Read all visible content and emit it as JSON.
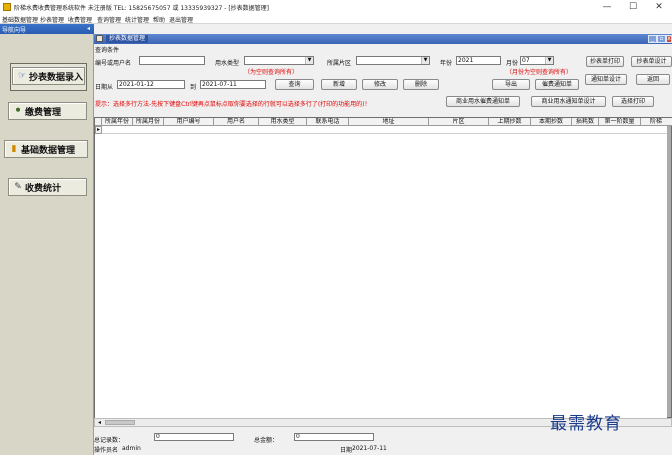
{
  "window": {
    "title": "阶梯水费收费管理系统软件 未注册版 TEL: 15825675057 或 13335939327 - [抄表数据管理]",
    "min_glyph": "—",
    "max_glyph": "☐",
    "close_glyph": "✕"
  },
  "menubar": [
    "基础数据管理",
    "抄表管理",
    "收费管理",
    "查询管理",
    "统计管理",
    "帮助",
    "退出管理"
  ],
  "nav": {
    "header": "导航向导",
    "pin": "◂",
    "items": [
      {
        "label": "抄表数据录入",
        "icon": "☞",
        "icon_name": "hand-icon"
      },
      {
        "label": "缴费管理",
        "icon": "⚫",
        "icon_name": "money-bag-icon"
      },
      {
        "label": "基础数据管理",
        "icon": "▮",
        "icon_name": "database-icon"
      },
      {
        "label": "收费统计",
        "icon": "✎",
        "icon_name": "chart-icon"
      }
    ]
  },
  "child": {
    "tab": "抄表数据管理",
    "min": "_",
    "max": "▫",
    "close": "x"
  },
  "query": {
    "group_title": "查询条件",
    "no_or_name_label": "编号或用户名",
    "no_or_name_value": "",
    "water_type_label": "用水类型",
    "water_type_value": "",
    "water_type_hint": "（为空则查询所有）",
    "area_label": "所属片区",
    "area_value": "",
    "year_label": "年份",
    "year_value": "2021",
    "month_label": "月份",
    "month_value": "07",
    "month_hint": "（月份为空则查询所有）",
    "date_from_label": "日期从",
    "date_from_value": "2021-01-12",
    "date_to_label": "到",
    "date_to_value": "2021-07-11",
    "tip": "提示：选择多行方法-先按下键盘Ctrl键再点鼠标点取你要选择的行就可以选择多行了(打印的功能用的)！",
    "dropdown_glyph": "▼"
  },
  "buttons": {
    "query": "查询",
    "add": "新增",
    "edit": "修改",
    "delete": "删除",
    "export": "导出",
    "fee_notice": "催费通知单",
    "print_meter": "抄表单打印",
    "meter_setup": "抄表单设计",
    "notice_setup": "通知单设计",
    "back": "返回",
    "biz_fee_notice": "商业用水催费通知单",
    "biz_notice_setup": "商业用水通知单设计",
    "select_print": "选择打印"
  },
  "grid": {
    "columns": [
      "所属年份",
      "所属月份",
      "用户编号",
      "用户名",
      "用水类型",
      "联系电话",
      "地址",
      "片区",
      "上期抄数",
      "本期抄数",
      "损耗数",
      "第一阶数量",
      "阶梯"
    ],
    "row_indicator": "▸",
    "hscroll_left": "◂"
  },
  "summary": {
    "record_label": "总记录数：",
    "record_value": "0",
    "amount_label": "总金额：",
    "amount_value": "0",
    "operator_label": "操作员名",
    "operator_value": "admin",
    "date_label": "日期",
    "date_value": "2021-07-11"
  },
  "watermark": "最需教育"
}
